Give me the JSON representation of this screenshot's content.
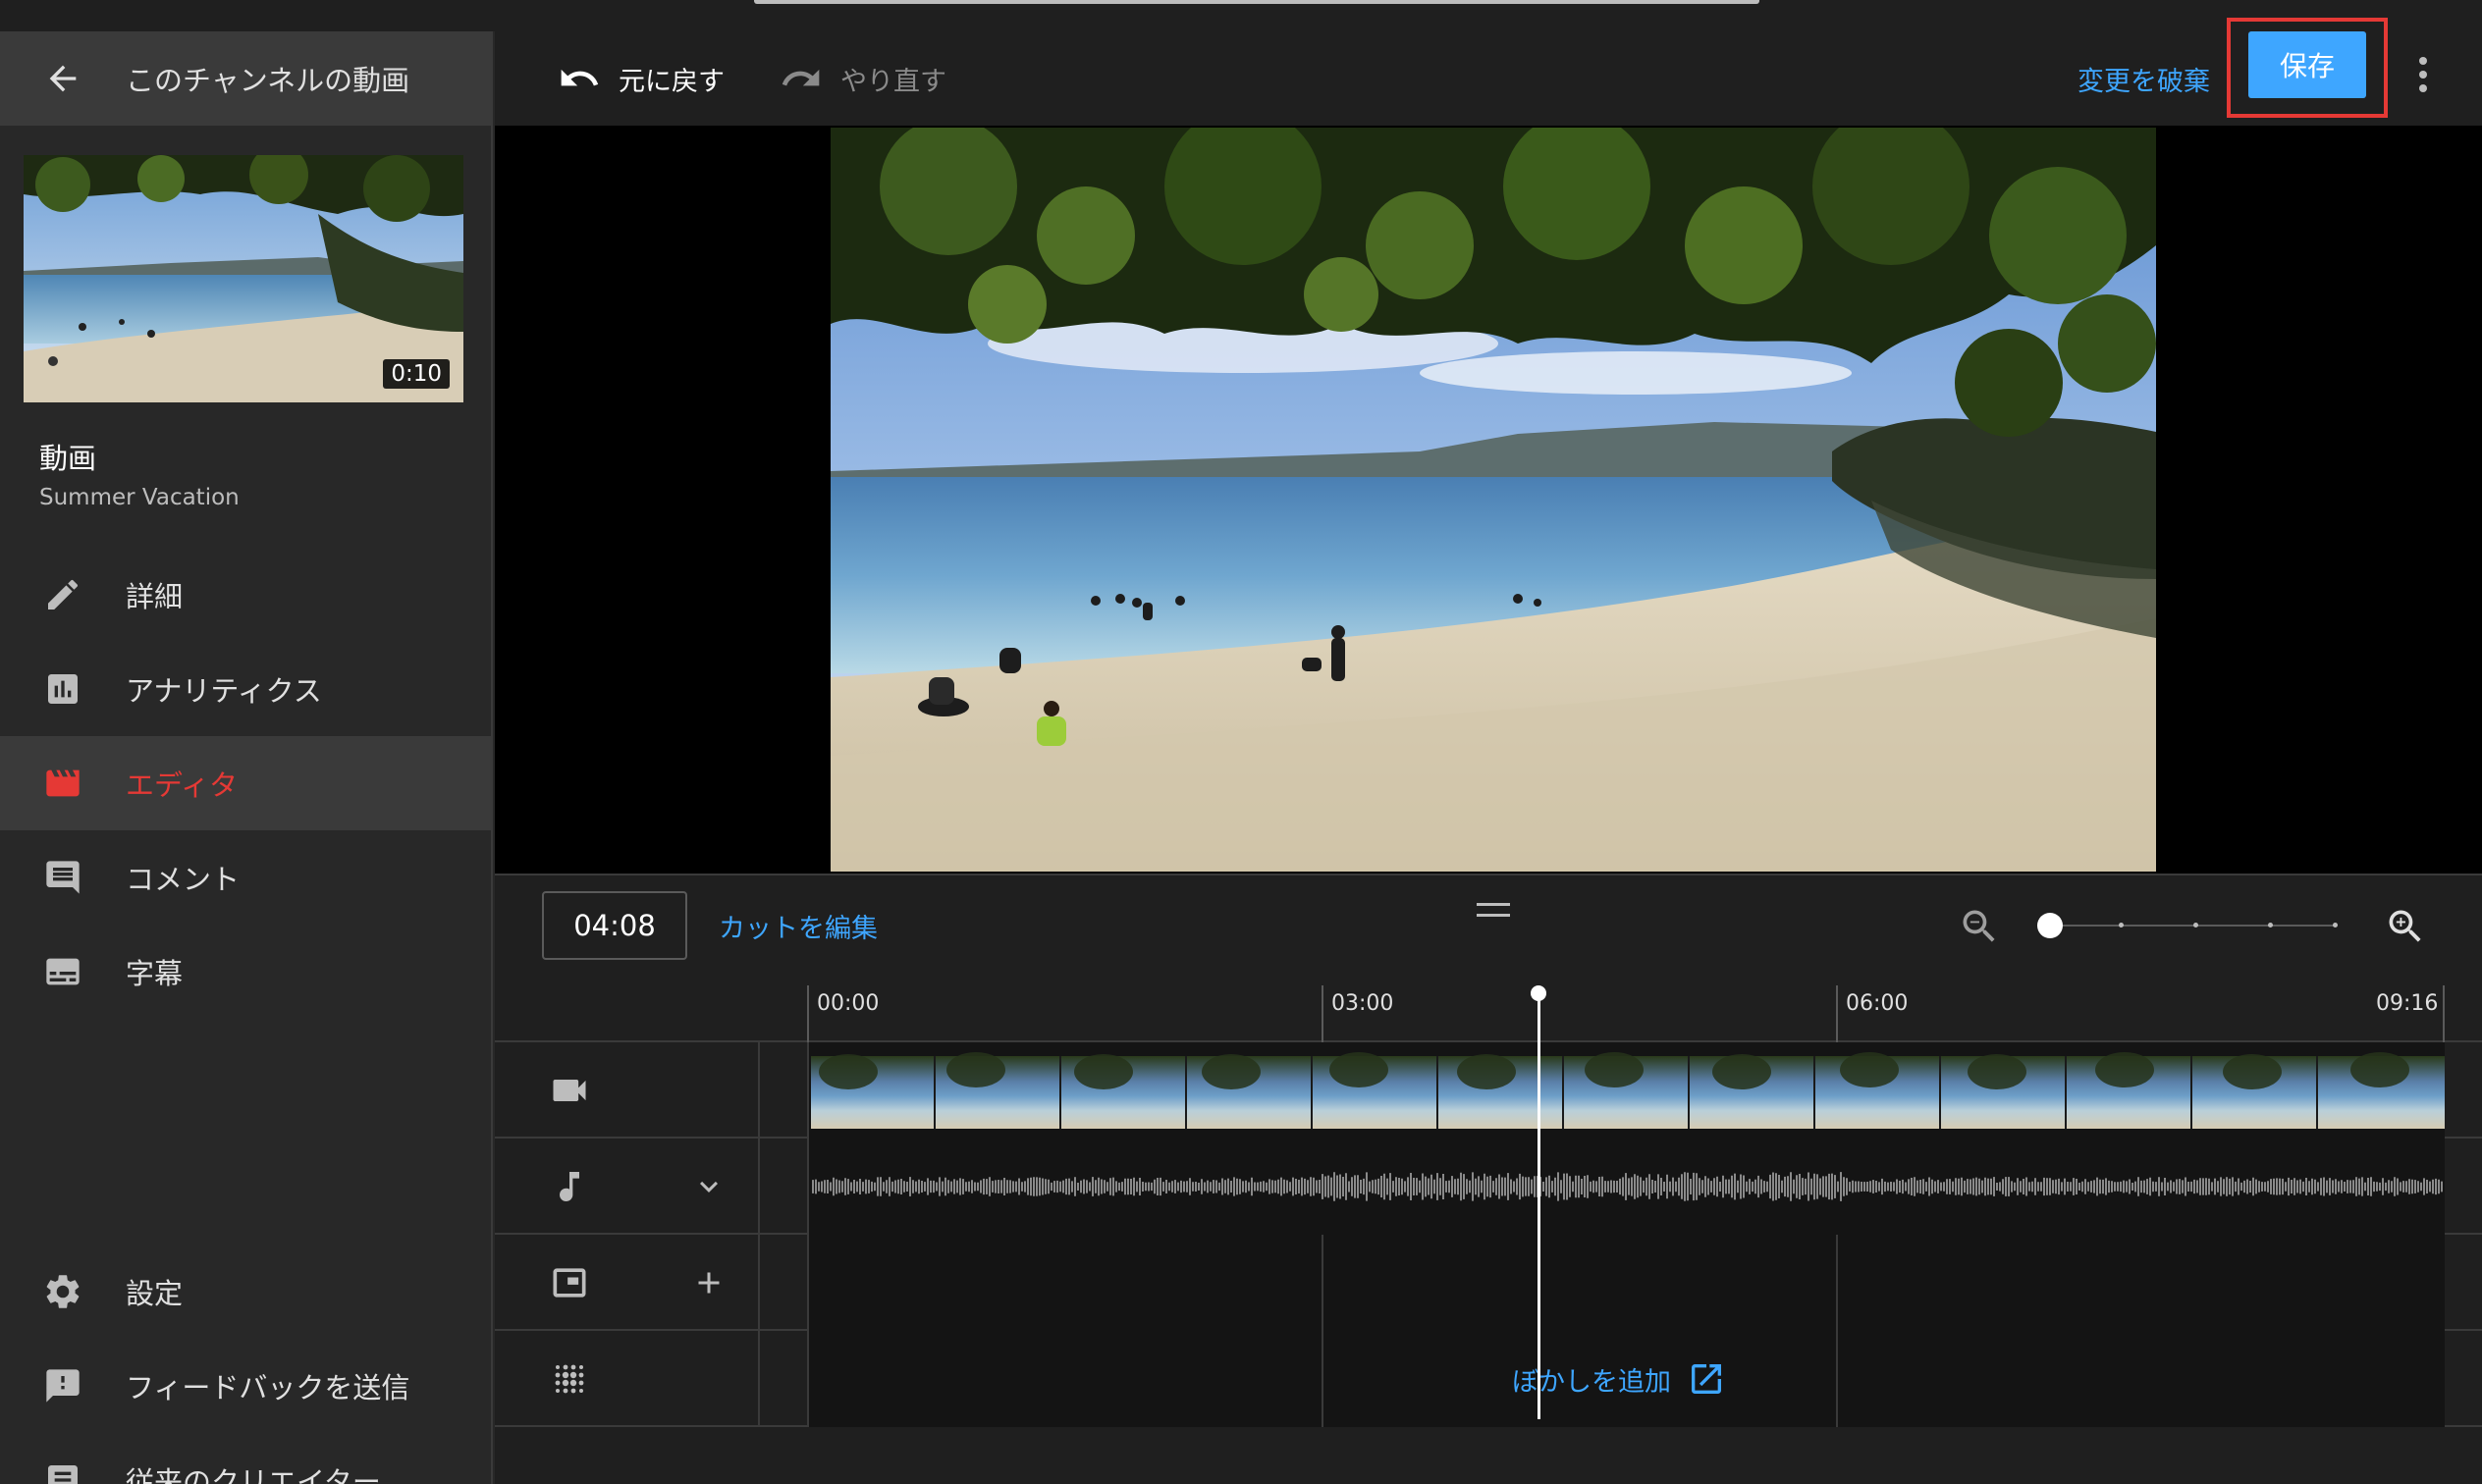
{
  "sidebar": {
    "header_title": "このチャンネルの動画",
    "thumbnail_duration": "0:10",
    "video_label": "動画",
    "video_title": "Summer Vacation",
    "items": [
      {
        "label": "詳細",
        "icon": "pencil-icon"
      },
      {
        "label": "アナリティクス",
        "icon": "analytics-icon"
      },
      {
        "label": "エディタ",
        "icon": "editor-clapper-icon",
        "active": true
      },
      {
        "label": "コメント",
        "icon": "comment-icon"
      },
      {
        "label": "字幕",
        "icon": "subtitles-icon"
      }
    ],
    "bottom_items": [
      {
        "label": "設定",
        "icon": "gear-icon"
      },
      {
        "label": "フィードバックを送信",
        "icon": "feedback-icon"
      },
      {
        "label": "従来のクリエイター",
        "icon": "classic-studio-icon"
      }
    ]
  },
  "toolbar": {
    "undo_label": "元に戻す",
    "redo_label": "やり直す",
    "discard_label": "変更を破棄",
    "save_label": "保存"
  },
  "timeline": {
    "current_time": "04:08",
    "cut_edit_label": "カットを編集",
    "ruler": [
      "00:00",
      "03:00",
      "06:00",
      "09:16"
    ],
    "blur_add_label": "ぼかしを追加",
    "zoom_level": 0
  },
  "colors": {
    "accent_blue": "#3ea6ff",
    "active_red": "#e53935",
    "highlight_box": "#e53935"
  }
}
